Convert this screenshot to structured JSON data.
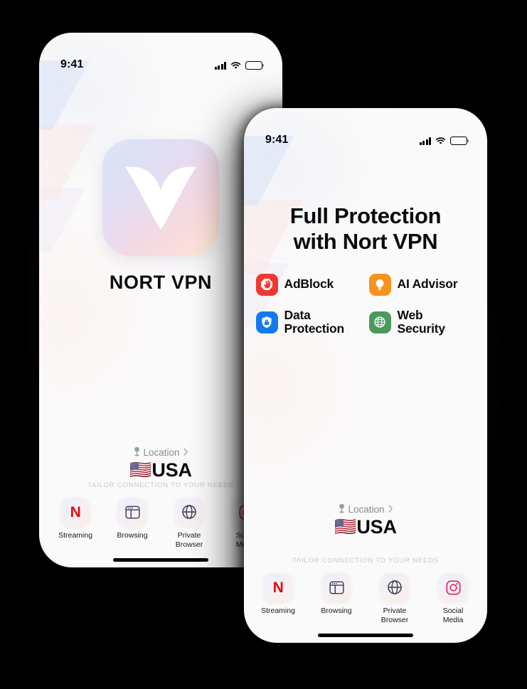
{
  "meta": {
    "scene": "Two iPhone mockups showing the Nort VPN app on a black background"
  },
  "status_bar": {
    "time": "9:41",
    "signal_icon": "cellular-bars-icon",
    "wifi_icon": "wifi-icon",
    "battery_icon": "battery-full-icon"
  },
  "back_phone": {
    "app_icon_name": "nort-vpn-app-icon",
    "app_title": "NORT VPN",
    "location": {
      "pin_icon": "location-pin-icon",
      "label": "Location",
      "chevron_icon": "chevron-right-icon",
      "flag": "🇺🇸",
      "country": "USA"
    },
    "tray": {
      "caption": "TAILOR CONNECTION TO YOUR NEEDS",
      "shortcuts": [
        {
          "icon": "netflix-n-icon",
          "glyph": "N",
          "label": "Streaming"
        },
        {
          "icon": "browser-window-icon",
          "label": "Browsing"
        },
        {
          "icon": "globe-icon",
          "label": "Private\nBrowser",
          "line1": "Private",
          "line2": "Browser"
        },
        {
          "icon": "instagram-icon",
          "label": "Social\nMedia",
          "line1": "Social",
          "line2": "Media"
        }
      ]
    }
  },
  "front_phone": {
    "headline_line1": "Full Protection",
    "headline_line2": "with Nort VPN",
    "features": [
      {
        "id": "adblock",
        "icon": "stop-hand-icon",
        "label": "AdBlock",
        "color": "#F2382E"
      },
      {
        "id": "ai-advisor",
        "icon": "lightbulb-icon",
        "label": "AI Advisor",
        "color": "#F7931E"
      },
      {
        "id": "data-protection",
        "icon": "shield-lock-icon",
        "label_line1": "Data",
        "label_line2": "Protection",
        "label": "Data Protection",
        "color": "#1379F1"
      },
      {
        "id": "web-security",
        "icon": "globe-icon",
        "label_line1": "Web",
        "label_line2": "Security",
        "label": "Web Security",
        "color": "#4A9A5E"
      }
    ],
    "location": {
      "pin_icon": "location-pin-icon",
      "label": "Location",
      "chevron_icon": "chevron-right-icon",
      "flag": "🇺🇸",
      "country": "USA"
    },
    "tray": {
      "caption": "TAILOR CONNECTION TO YOUR NEEDS",
      "shortcuts": [
        {
          "icon": "netflix-n-icon",
          "glyph": "N",
          "label": "Streaming",
          "line1": "Streaming",
          "line2": ""
        },
        {
          "icon": "browser-window-icon",
          "label": "Browsing",
          "line1": "Browsing",
          "line2": ""
        },
        {
          "icon": "globe-icon",
          "label": "Private Browser",
          "line1": "Private",
          "line2": "Browser"
        },
        {
          "icon": "instagram-icon",
          "label": "Social Media",
          "line1": "Social",
          "line2": "Media"
        }
      ]
    }
  },
  "colors": {
    "background": "#000000",
    "screen": "#FBFAFA",
    "text_primary": "#0B0B0D",
    "text_muted": "#8B8B90",
    "caption": "#C9C9CE",
    "netflix_red": "#E50914"
  }
}
